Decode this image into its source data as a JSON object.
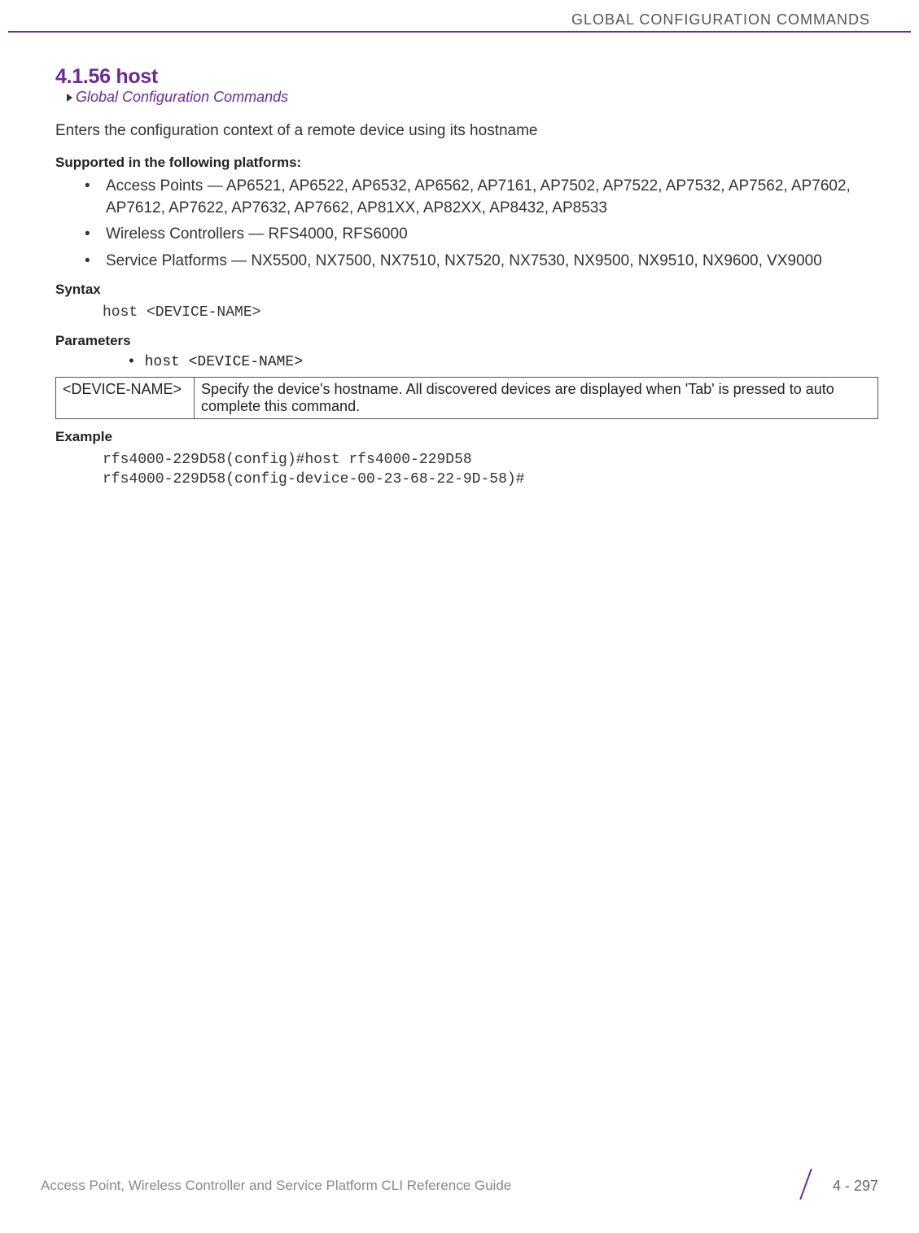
{
  "header": {
    "chapter_title": "GLOBAL CONFIGURATION COMMANDS"
  },
  "section": {
    "number_title": "4.1.56 host",
    "breadcrumb": "Global Configuration Commands",
    "intro": "Enters the configuration context of a remote device using its hostname"
  },
  "supported": {
    "heading": "Supported in the following platforms:",
    "items": [
      "Access Points — AP6521, AP6522, AP6532, AP6562, AP7161, AP7502, AP7522, AP7532, AP7562, AP7602, AP7612, AP7622, AP7632, AP7662, AP81XX, AP82XX, AP8432, AP8533",
      "Wireless Controllers — RFS4000, RFS6000",
      "Service Platforms — NX5500, NX7500, NX7510, NX7520, NX7530, NX9500, NX9510, NX9600, VX9000"
    ]
  },
  "syntax": {
    "heading": "Syntax",
    "code": "host <DEVICE-NAME>"
  },
  "parameters": {
    "heading": "Parameters",
    "line": "• host <DEVICE-NAME>",
    "table": {
      "name": "<DEVICE-NAME>",
      "desc": "Specify the device's hostname. All discovered devices are displayed when 'Tab' is pressed to auto complete this command."
    }
  },
  "example": {
    "heading": "Example",
    "code": "rfs4000-229D58(config)#host rfs4000-229D58\nrfs4000-229D58(config-device-00-23-68-22-9D-58)#"
  },
  "footer": {
    "guide_title": "Access Point, Wireless Controller and Service Platform CLI Reference Guide",
    "page_num": "4 - 297"
  }
}
